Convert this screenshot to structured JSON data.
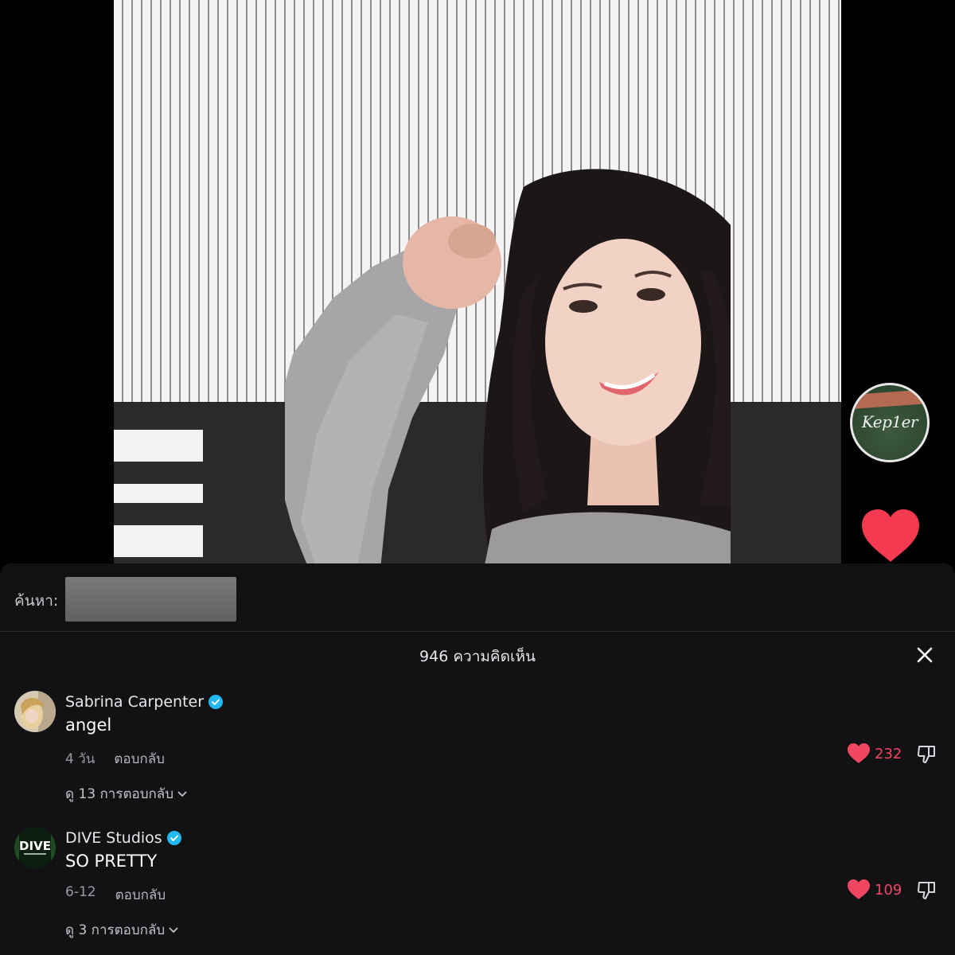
{
  "video": {
    "channel_logo_text": "Kep1er"
  },
  "search": {
    "label": "ค้นหา:",
    "value": ""
  },
  "comments_panel": {
    "title": "946 ความคิดเห็น",
    "comments": [
      {
        "author": "Sabrina Carpenter",
        "verified": true,
        "text": "angel",
        "time": "4 วัน",
        "reply_label": "ตอบกลับ",
        "likes": "232",
        "view_replies": "ดู 13 การตอบกลับ"
      },
      {
        "author": "DIVE Studios",
        "verified": true,
        "text": "SO PRETTY",
        "time": "6-12",
        "reply_label": "ตอบกลับ",
        "likes": "109",
        "view_replies": "ดู 3 การตอบกลับ",
        "avatar_text": "DIVE"
      }
    ]
  },
  "colors": {
    "panel_bg": "#121214",
    "like_red": "#f04662",
    "verified_blue": "#20b8f0",
    "heart_red": "#f33a50"
  },
  "icons": [
    "heart-icon",
    "close-icon",
    "verified-icon",
    "dislike-icon",
    "chevron-down-icon"
  ]
}
